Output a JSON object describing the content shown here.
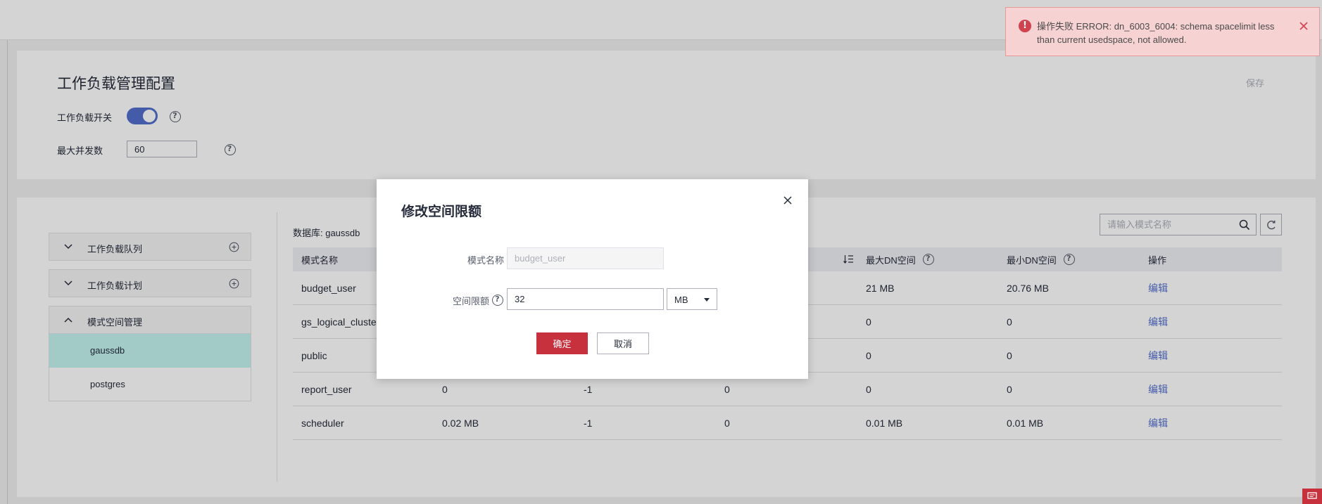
{
  "config_panel": {
    "title": "工作负载管理配置",
    "save_label": "保存",
    "switch_label": "工作负载开关",
    "switch_on": true,
    "max_concurrency_label": "最大并发数",
    "max_concurrency_value": "60"
  },
  "sidebar": {
    "items": [
      {
        "label": "工作负载队列",
        "icon": "chevron-down-icon",
        "action_icon": "plus-circle-icon"
      },
      {
        "label": "工作负载计划",
        "icon": "chevron-down-icon",
        "action_icon": "plus-circle-icon"
      },
      {
        "label": "模式空间管理",
        "icon": "chevron-up-icon",
        "expanded": true,
        "children": [
          {
            "label": "gaussdb",
            "selected": true
          },
          {
            "label": "postgres",
            "selected": false
          }
        ]
      }
    ]
  },
  "main": {
    "database_label": "数据库: gaussdb",
    "search_placeholder": "请输入模式名称",
    "table": {
      "columns": [
        {
          "label": "模式名称"
        },
        {
          "label": ""
        },
        {
          "label": ""
        },
        {
          "label": "",
          "icon": "sort-icon"
        },
        {
          "label": "最大DN空间",
          "help": true
        },
        {
          "label": "最小DN空间",
          "help": true
        },
        {
          "label": "操作"
        }
      ],
      "rows": [
        {
          "cells": [
            "budget_user",
            "",
            "",
            "",
            "21 MB",
            "20.76 MB",
            "编辑"
          ]
        },
        {
          "cells": [
            "gs_logical_cluster",
            "",
            "",
            "",
            "0",
            "0",
            "编辑"
          ]
        },
        {
          "cells": [
            "public",
            "",
            "",
            "",
            "0",
            "0",
            "编辑"
          ]
        },
        {
          "cells": [
            "report_user",
            "0",
            "-1",
            "0",
            "0",
            "0",
            "编辑"
          ]
        },
        {
          "cells": [
            "scheduler",
            "0.02 MB",
            "-1",
            "0",
            "0.01 MB",
            "0.01 MB",
            "编辑"
          ]
        }
      ]
    }
  },
  "modal": {
    "title": "修改空间限额",
    "schema_name_label": "模式名称",
    "schema_name_value": "budget_user",
    "space_limit_label": "空间限额",
    "space_limit_value": "32",
    "unit": "MB",
    "confirm_label": "确定",
    "cancel_label": "取消"
  },
  "toast": {
    "type": "error",
    "icon": "error-icon",
    "lines": [
      "操作失败 ERROR: dn_6003_6004: schema spacelimit less",
      "than current usedspace, not allowed."
    ]
  },
  "colors": {
    "accent": "#526ecc",
    "danger": "#c7303d",
    "selected_bg": "#c3f5f0",
    "toast_bg": "#f6d2d2"
  }
}
